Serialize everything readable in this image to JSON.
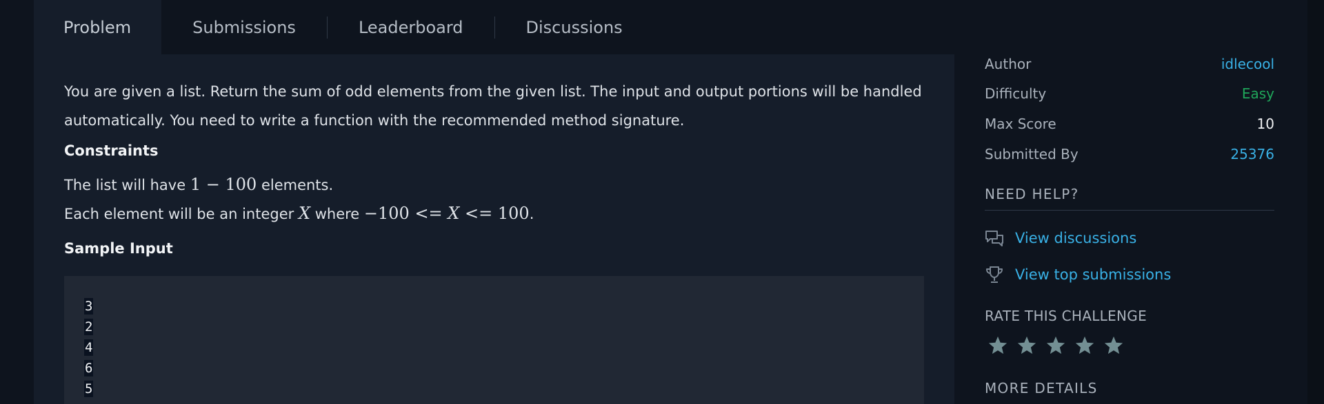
{
  "tabs": [
    {
      "label": "Problem",
      "active": true
    },
    {
      "label": "Submissions",
      "active": false
    },
    {
      "label": "Leaderboard",
      "active": false
    },
    {
      "label": "Discussions",
      "active": false
    }
  ],
  "problem": {
    "description_line1": "You are given a list. Return the sum of odd elements from the given list. The input and output portions will be handled",
    "description_line2": "automatically. You need to write a function with the recommended method signature.",
    "constraints_heading": "Constraints",
    "constraint1": {
      "pre": "The list will have ",
      "math": "1 − 100",
      "post": " elements."
    },
    "constraint2": {
      "pre": "Each element will be an integer ",
      "var": "X",
      "mid": " where ",
      "math_a": "−100 <= ",
      "var2": "X",
      "math_b": " <= 100",
      "post": "."
    },
    "sample_input_heading": "Sample Input",
    "sample_input_lines": [
      "3",
      "2",
      "4",
      "6",
      "5"
    ]
  },
  "sidebar": {
    "author_label": "Author",
    "author_value": "idlecool",
    "difficulty_label": "Difficulty",
    "difficulty_value": "Easy",
    "max_score_label": "Max Score",
    "max_score_value": "10",
    "submitted_by_label": "Submitted By",
    "submitted_by_value": "25376",
    "need_help_title": "NEED HELP?",
    "view_discussions": "View discussions",
    "view_top_submissions": "View top submissions",
    "rate_title": "RATE THIS CHALLENGE",
    "rating_filled": 0,
    "rating_max": 5,
    "more_details_title": "MORE DETAILS"
  },
  "colors": {
    "background": "#0e141e",
    "panel": "#151d2a",
    "code_bg": "#212834",
    "link": "#39b1e6",
    "easy": "#1fa65a",
    "star": "#738f93"
  },
  "icons": [
    "discussion-icon",
    "trophy-icon",
    "star-icon"
  ]
}
